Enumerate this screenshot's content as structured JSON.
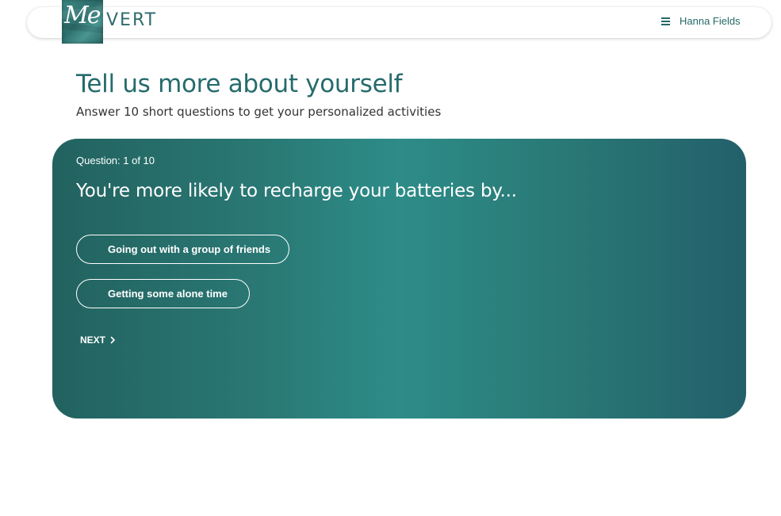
{
  "header": {
    "logo_script": "Me",
    "logo_word": "VERT",
    "menu_icon": "hamburger-menu-icon",
    "user_name": "Hanna Fields"
  },
  "intro": {
    "title": "Tell us more about yourself",
    "subtitle": "Answer 10 short questions to get your personalized activities"
  },
  "question": {
    "counter": "Question: 1 of 10",
    "text": "You're more likely to recharge your batteries by...",
    "options": [
      {
        "label": "Going out with a group of friends"
      },
      {
        "label": "Getting some alone time"
      }
    ],
    "next_label": "NEXT",
    "next_icon": "chevron-right-icon"
  },
  "colors": {
    "brand_teal": "#266b6c",
    "card_dark": "#22625f",
    "card_light": "#2d8c88",
    "text_on_card": "#ffffff"
  }
}
